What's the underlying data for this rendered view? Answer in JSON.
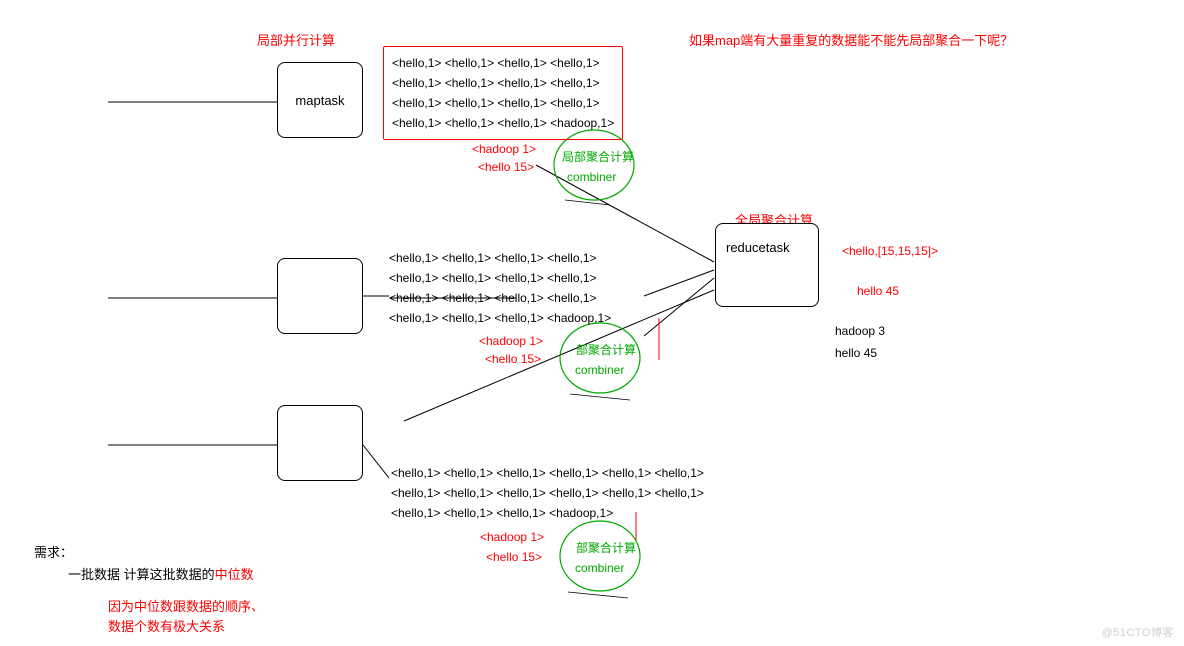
{
  "labels": {
    "local_parallel": "局部并行计算",
    "question": "如果map端有大量重复的数据能不能先局部聚合一下呢？",
    "local_agg": "局部聚合计算",
    "local_agg_suffix": "部聚合计算",
    "global_agg": "全局聚合计算",
    "combiner": "combiner",
    "maptask": "maptask",
    "reducetask": "reducetask"
  },
  "combined": {
    "hadoop": "<hadoop 1>",
    "hello": "<hello 15>"
  },
  "reduce_out": {
    "intermediate": "<hello,[15,15,15]>",
    "hello": "hello 45",
    "hadoop": "hadoop 3",
    "hello2": "hello 45"
  },
  "kv1": {
    "r1": "<hello,1> <hello,1> <hello,1> <hello,1>",
    "r2": "<hello,1> <hello,1> <hello,1> <hello,1>",
    "r3": "<hello,1> <hello,1> <hello,1> <hello,1>",
    "r4": "<hello,1> <hello,1> <hello,1> <hadoop,1>"
  },
  "kv2": {
    "r1": "<hello,1> <hello,1> <hello,1> <hello,1>",
    "r2": "<hello,1> <hello,1> <hello,1> <hello,1>",
    "r3": "<hello,1> <hello,1> <hello,1> <hello,1>",
    "r4": "<hello,1> <hello,1> <hello,1> <hadoop,1>"
  },
  "kv3": {
    "r1": "<hello,1> <hello,1> <hello,1> <hello,1> <hello,1> <hello,1>",
    "r2": "<hello,1> <hello,1> <hello,1> <hello,1> <hello,1> <hello,1>",
    "r3": "<hello,1> <hello,1> <hello,1> <hadoop,1>"
  },
  "requirement": {
    "title": "需求：",
    "desc_a": "一批数据 计算这批数据的",
    "desc_b": "中位数",
    "note1": "因为中位数跟数据的顺序、",
    "note2": "数据个数有极大关系"
  },
  "watermark": "@51CTO博客"
}
